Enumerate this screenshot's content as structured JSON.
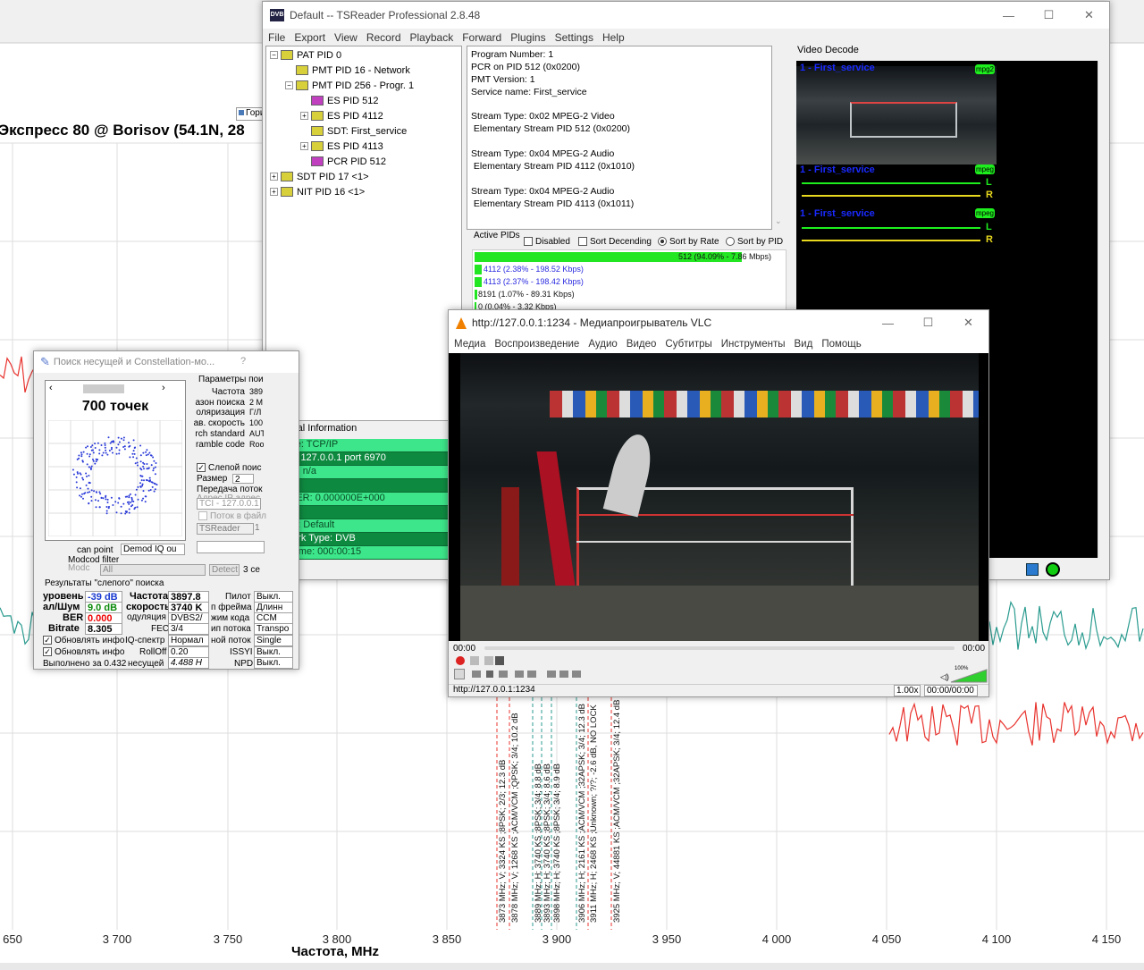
{
  "background_chart": {
    "title": "Экспресс 80 @ Borisov (54.1N, 28",
    "xlabel": "Частота, MHz",
    "ticks": [
      "650",
      "3 700",
      "3 750",
      "3 800",
      "3 850",
      "3 900",
      "3 950",
      "4 000",
      "4 050",
      "4 100",
      "4 150"
    ],
    "legend": "Гори",
    "annotations": [
      "3873 MHz; V; 3324 KS ;8PSK; 2/3; 12.3 dB",
      "3878 MHz; V; 1268 KS ;ACM/VCM ;QPSK; 3/4; 10.2 dB",
      "3889 MHz; H; 3740 KS ;8PSK; 3/4; 8.8 dB",
      "3893 MHz; H; 3740 KS ;8PSK; 3/4; 8.6 dB",
      "3898 MHz; H; 3740 KS ;8PSK; 3/4; 8.9 dB",
      "3906 MHz; H; 2161 KS ;ACM/VCM ;32APSK; 3/4; 12.3 dB",
      "3911 MHz; H; 2468 KS ;Unknown; ?/?; -2.6 dB, NO LOCK",
      "3925 MHz; V; 44881 KS ;ACM/VCM ;32APSK; 3/4; 12.4 dB"
    ],
    "colors": {
      "red": "#e8332e",
      "teal": "#2a9b8f"
    }
  },
  "tsreader": {
    "title": "Default -- TSReader Professional 2.8.48",
    "menu": [
      "File",
      "Export",
      "View",
      "Record",
      "Playback",
      "Forward",
      "Plugins",
      "Settings",
      "Help"
    ],
    "tree": [
      {
        "label": "PAT PID 0",
        "indent": 0,
        "pm": "−",
        "icon": "yellow"
      },
      {
        "label": "PMT PID 16 - Network",
        "indent": 1,
        "pm": "",
        "icon": "yellow"
      },
      {
        "label": "PMT PID 256 - Progr. 1",
        "indent": 1,
        "pm": "−",
        "icon": "yellow"
      },
      {
        "label": "ES PID 512",
        "indent": 2,
        "pm": "",
        "icon": "pink"
      },
      {
        "label": "ES PID 4112",
        "indent": 2,
        "pm": "+",
        "icon": "yellow"
      },
      {
        "label": "SDT: First_service",
        "indent": 2,
        "pm": "",
        "icon": "yellow"
      },
      {
        "label": "ES PID 4113",
        "indent": 2,
        "pm": "+",
        "icon": "yellow"
      },
      {
        "label": "PCR PID 512",
        "indent": 2,
        "pm": "",
        "icon": "pink"
      },
      {
        "label": "SDT PID 17 <1>",
        "indent": 0,
        "pm": "+",
        "icon": "yellow"
      },
      {
        "label": "NIT PID 16 <1>",
        "indent": 0,
        "pm": "+",
        "icon": "yellow"
      }
    ],
    "info": [
      "Program Number: 1",
      "PCR on PID 512 (0x0200)",
      "PMT Version: 1",
      "Service name: First_service",
      "",
      "Stream Type: 0x02 MPEG-2 Video",
      " Elementary Stream PID 512 (0x0200)",
      "",
      "Stream Type: 0x04 MPEG-2 Audio",
      " Elementary Stream PID 4112 (0x1010)",
      "",
      "Stream Type: 0x04 MPEG-2 Audio",
      " Elementary Stream PID 4113 (0x1011)"
    ],
    "active_pids": {
      "title": "Active PIDs",
      "disabled": "Disabled",
      "sort_desc": "Sort Decending",
      "sort_rate": "Sort by Rate",
      "sort_pid": "Sort by PID",
      "rows": [
        {
          "text": "512 (94.09% - 7.86 Mbps)",
          "fraction": 0.94
        },
        {
          "text": "4112 (2.38% - 198.52 Kbps)",
          "fraction": 0.024
        },
        {
          "text": "4113 (2.37% - 198.42 Kbps)",
          "fraction": 0.024
        },
        {
          "text": "8191 (1.07% - 89.31 Kbps)",
          "fraction": 0.011
        },
        {
          "text": "0 (0.04% - 3.32 Kbps)",
          "fraction": 0.0
        }
      ]
    },
    "video_decode": {
      "title": "Video Decode",
      "service_1": "1 - First_service",
      "service_2": "1 - First_service",
      "service_3": "1 - First_service",
      "badge_video": "mpg2",
      "badge_audio": "mpeg",
      "left": "L",
      "right": "R"
    },
    "general_info": {
      "title": "General Information",
      "rows": [
        "Source: TCP/IP",
        "Tuner: 127.0.0.1 port 6970",
        "Signal: n/a",
        "",
        "Null BER: 0.000000E+000",
        "",
        "Profile: Default",
        "Network Type: DVB",
        "Run Time: 000:00:15"
      ]
    }
  },
  "search": {
    "title": "Поиск несущей и Constellation-мо...",
    "help": "?",
    "points": "700 точек",
    "params_title": "Параметры пои",
    "params": [
      {
        "l": "Частота",
        "v": "389"
      },
      {
        "l": "азон поиска",
        "v": "2 М"
      },
      {
        "l": "оляризация",
        "v": "Г/Л"
      },
      {
        "l": "ав. скорость",
        "v": "100"
      },
      {
        "l": "rch standard",
        "v": "AUT"
      },
      {
        "l": "ramble code",
        "v": "Roo"
      }
    ],
    "blind_search": "Слепой поис",
    "size_label": "Размер",
    "size_value": "2",
    "stream_transfer": "Передача поток",
    "ip_address": "Адрес IP адрес",
    "tci_value": "TCI - 127.0.0.1",
    "stream_in_file": "Поток в файл",
    "tsreader": "TSReader",
    "scan_point": "can point",
    "scan_select": "Demod IQ ou",
    "modcod_filter": "Modcod filter",
    "modc": "Modc",
    "all": "All",
    "detect": "Detect",
    "detect_val": "3 се",
    "results_title": "Результаты \"слепого\" поиска",
    "level_label": "уровень",
    "level_value": "-39 dB",
    "snr_label": "ал/Шум",
    "snr_value": "9.0 dB",
    "ber_label": "BER",
    "ber_value": "0.000",
    "bitrate_label": "Bitrate",
    "bitrate_value": "8.305",
    "freq_label": "Частота",
    "freq_value": "3897.8",
    "speed_label": "скорость",
    "speed_value": "3740 K",
    "mod_label": "одуляция",
    "mod_value": "DVBS2/",
    "fec_label": "FEC",
    "fec_value": "3/4",
    "iq_label": "IQ-спектр",
    "iq_value": "Нормал",
    "rolloff_label": "RollOff",
    "rolloff_value": "0.20",
    "carrier_label": "несущей",
    "carrier_value": "4.488 H",
    "pilot_label": "Пилот",
    "pilot_value": "Выкл.",
    "frame_label": "п фрейма",
    "frame_value": "Длинн",
    "code_label": "жим кода",
    "code_value": "CCM",
    "stype_label": "ип потока",
    "stype_value": "Transpo",
    "istream_label": "ной поток",
    "istream_value": "Single",
    "issyi_label": "ISSYI",
    "issyi_value": "Выкл.",
    "npd_label": "NPD",
    "npd_value": "Выкл.",
    "update1": "Обновлять инфо",
    "update2": "Обновлять инфо",
    "done": "Выполнено за 0.432",
    "flag_value": "1"
  },
  "vlc": {
    "title": "http://127.0.0.1:1234 - Медиапроигрыватель VLC",
    "menu": [
      "Медиа",
      "Воспроизведение",
      "Аудио",
      "Видео",
      "Субтитры",
      "Инструменты",
      "Вид",
      "Помощь"
    ],
    "time_left": "00:00",
    "time_right": "00:00",
    "url": "http://127.0.0.1:1234",
    "speed": "1.00x",
    "time_total": "00:00/00:00",
    "volume": "100%"
  }
}
